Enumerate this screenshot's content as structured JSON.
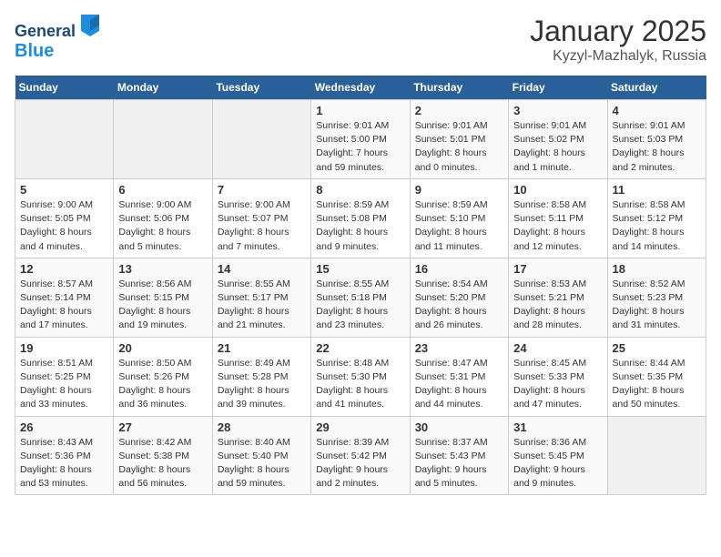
{
  "header": {
    "logo_line1": "General",
    "logo_line2": "Blue",
    "month": "January 2025",
    "location": "Kyzyl-Mazhalyk, Russia"
  },
  "weekdays": [
    "Sunday",
    "Monday",
    "Tuesday",
    "Wednesday",
    "Thursday",
    "Friday",
    "Saturday"
  ],
  "weeks": [
    [
      {
        "day": "",
        "empty": true
      },
      {
        "day": "",
        "empty": true
      },
      {
        "day": "",
        "empty": true
      },
      {
        "day": "1",
        "sunrise": "9:01 AM",
        "sunset": "5:00 PM",
        "daylight": "7 hours and 59 minutes."
      },
      {
        "day": "2",
        "sunrise": "9:01 AM",
        "sunset": "5:01 PM",
        "daylight": "8 hours and 0 minutes."
      },
      {
        "day": "3",
        "sunrise": "9:01 AM",
        "sunset": "5:02 PM",
        "daylight": "8 hours and 1 minute."
      },
      {
        "day": "4",
        "sunrise": "9:01 AM",
        "sunset": "5:03 PM",
        "daylight": "8 hours and 2 minutes."
      }
    ],
    [
      {
        "day": "5",
        "sunrise": "9:00 AM",
        "sunset": "5:05 PM",
        "daylight": "8 hours and 4 minutes."
      },
      {
        "day": "6",
        "sunrise": "9:00 AM",
        "sunset": "5:06 PM",
        "daylight": "8 hours and 5 minutes."
      },
      {
        "day": "7",
        "sunrise": "9:00 AM",
        "sunset": "5:07 PM",
        "daylight": "8 hours and 7 minutes."
      },
      {
        "day": "8",
        "sunrise": "8:59 AM",
        "sunset": "5:08 PM",
        "daylight": "8 hours and 9 minutes."
      },
      {
        "day": "9",
        "sunrise": "8:59 AM",
        "sunset": "5:10 PM",
        "daylight": "8 hours and 11 minutes."
      },
      {
        "day": "10",
        "sunrise": "8:58 AM",
        "sunset": "5:11 PM",
        "daylight": "8 hours and 12 minutes."
      },
      {
        "day": "11",
        "sunrise": "8:58 AM",
        "sunset": "5:12 PM",
        "daylight": "8 hours and 14 minutes."
      }
    ],
    [
      {
        "day": "12",
        "sunrise": "8:57 AM",
        "sunset": "5:14 PM",
        "daylight": "8 hours and 17 minutes."
      },
      {
        "day": "13",
        "sunrise": "8:56 AM",
        "sunset": "5:15 PM",
        "daylight": "8 hours and 19 minutes."
      },
      {
        "day": "14",
        "sunrise": "8:55 AM",
        "sunset": "5:17 PM",
        "daylight": "8 hours and 21 minutes."
      },
      {
        "day": "15",
        "sunrise": "8:55 AM",
        "sunset": "5:18 PM",
        "daylight": "8 hours and 23 minutes."
      },
      {
        "day": "16",
        "sunrise": "8:54 AM",
        "sunset": "5:20 PM",
        "daylight": "8 hours and 26 minutes."
      },
      {
        "day": "17",
        "sunrise": "8:53 AM",
        "sunset": "5:21 PM",
        "daylight": "8 hours and 28 minutes."
      },
      {
        "day": "18",
        "sunrise": "8:52 AM",
        "sunset": "5:23 PM",
        "daylight": "8 hours and 31 minutes."
      }
    ],
    [
      {
        "day": "19",
        "sunrise": "8:51 AM",
        "sunset": "5:25 PM",
        "daylight": "8 hours and 33 minutes."
      },
      {
        "day": "20",
        "sunrise": "8:50 AM",
        "sunset": "5:26 PM",
        "daylight": "8 hours and 36 minutes."
      },
      {
        "day": "21",
        "sunrise": "8:49 AM",
        "sunset": "5:28 PM",
        "daylight": "8 hours and 39 minutes."
      },
      {
        "day": "22",
        "sunrise": "8:48 AM",
        "sunset": "5:30 PM",
        "daylight": "8 hours and 41 minutes."
      },
      {
        "day": "23",
        "sunrise": "8:47 AM",
        "sunset": "5:31 PM",
        "daylight": "8 hours and 44 minutes."
      },
      {
        "day": "24",
        "sunrise": "8:45 AM",
        "sunset": "5:33 PM",
        "daylight": "8 hours and 47 minutes."
      },
      {
        "day": "25",
        "sunrise": "8:44 AM",
        "sunset": "5:35 PM",
        "daylight": "8 hours and 50 minutes."
      }
    ],
    [
      {
        "day": "26",
        "sunrise": "8:43 AM",
        "sunset": "5:36 PM",
        "daylight": "8 hours and 53 minutes."
      },
      {
        "day": "27",
        "sunrise": "8:42 AM",
        "sunset": "5:38 PM",
        "daylight": "8 hours and 56 minutes."
      },
      {
        "day": "28",
        "sunrise": "8:40 AM",
        "sunset": "5:40 PM",
        "daylight": "8 hours and 59 minutes."
      },
      {
        "day": "29",
        "sunrise": "8:39 AM",
        "sunset": "5:42 PM",
        "daylight": "9 hours and 2 minutes."
      },
      {
        "day": "30",
        "sunrise": "8:37 AM",
        "sunset": "5:43 PM",
        "daylight": "9 hours and 5 minutes."
      },
      {
        "day": "31",
        "sunrise": "8:36 AM",
        "sunset": "5:45 PM",
        "daylight": "9 hours and 9 minutes."
      },
      {
        "day": "",
        "empty": true
      }
    ]
  ]
}
